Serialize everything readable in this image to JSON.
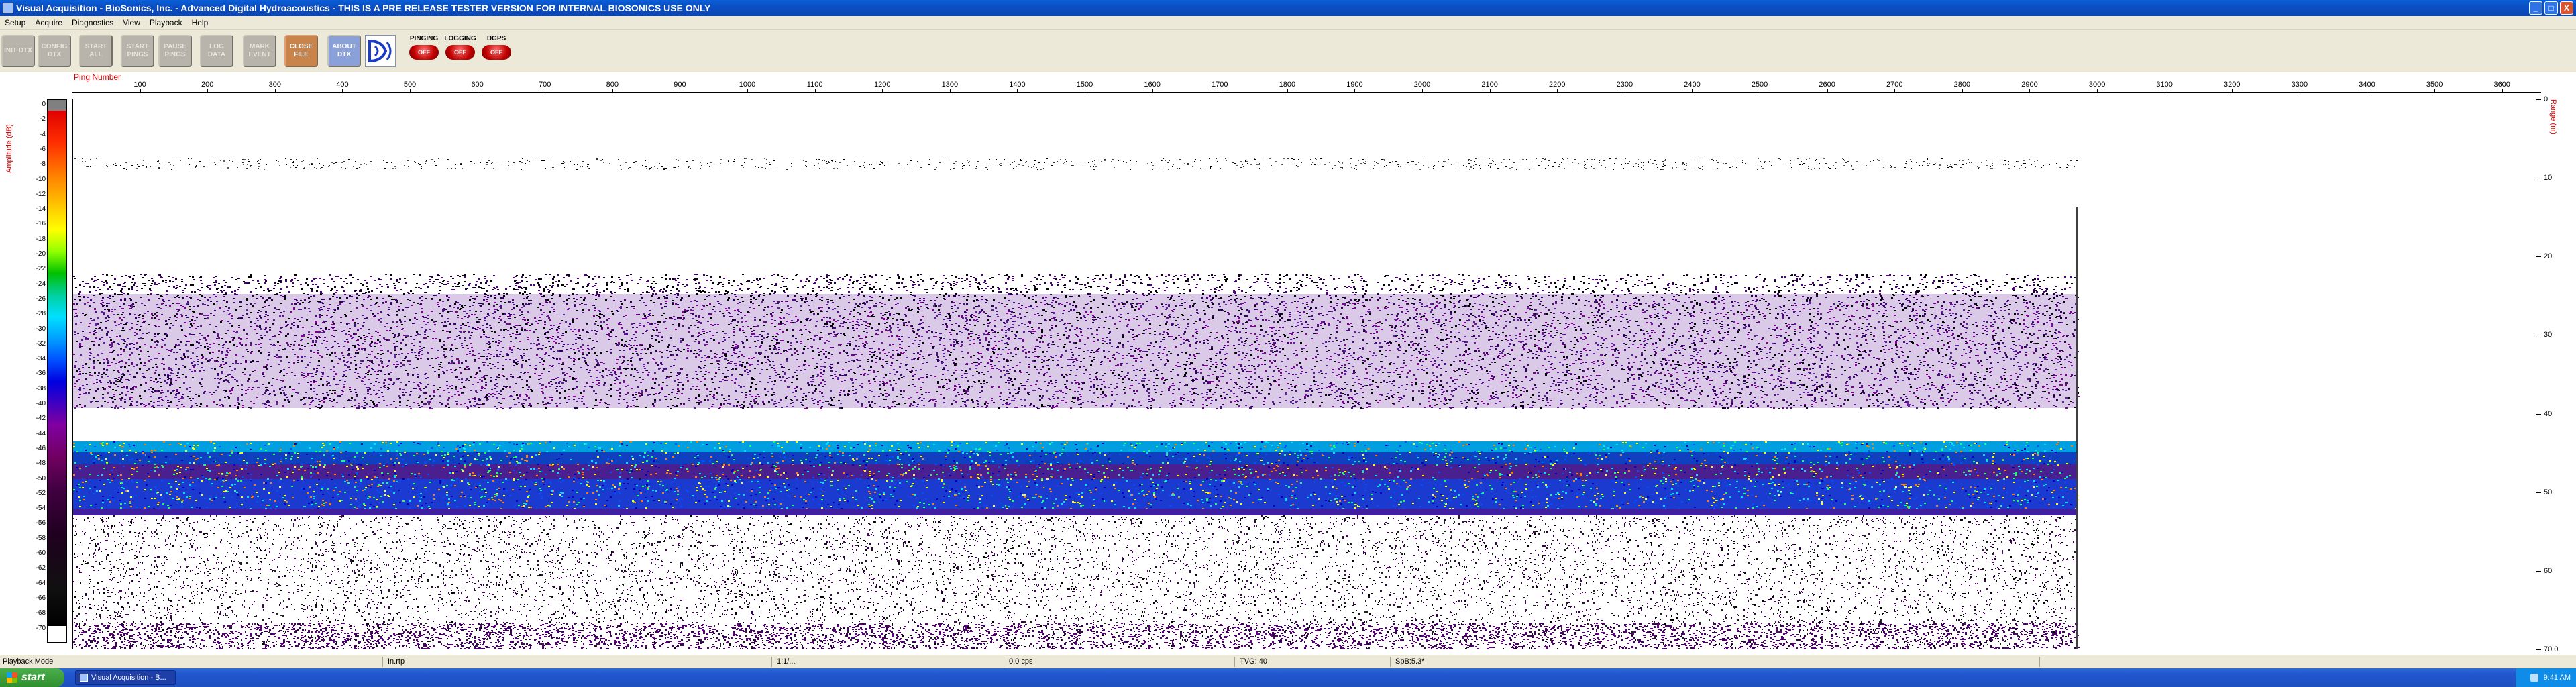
{
  "window": {
    "title": "Visual Acquisition  -  BioSonics, Inc.  -  Advanced Digital Hydroacoustics  -  THIS IS A PRE RELEASE TESTER VERSION FOR INTERNAL BIOSONICS USE ONLY",
    "min_label": "_",
    "max_label": "□",
    "close_label": "X"
  },
  "menu": [
    "Setup",
    "Acquire",
    "Diagnostics",
    "View",
    "Playback",
    "Help"
  ],
  "toolbar": {
    "buttons": [
      {
        "label": "INIT DTX"
      },
      {
        "label": "CONFIG DTX"
      },
      {
        "label": "START ALL"
      },
      {
        "label": "START PINGS"
      },
      {
        "label": "PAUSE PINGS"
      },
      {
        "label": "LOG DATA"
      },
      {
        "label": "MARK EVENT"
      },
      {
        "label": "CLOSE FILE"
      },
      {
        "label": "ABOUT DTX"
      }
    ],
    "status": [
      {
        "title": "PINGING",
        "state": "OFF"
      },
      {
        "title": "LOGGING",
        "state": "OFF"
      },
      {
        "title": "DGPS",
        "state": "OFF"
      }
    ]
  },
  "echogram": {
    "ping_label": "Ping Number",
    "amplitude_label": "Amplitude (dB)",
    "range_label": "Range (m)",
    "x_ticks": [
      "100",
      "200",
      "300",
      "400",
      "500",
      "600",
      "700",
      "800",
      "900",
      "1000",
      "1100",
      "1200",
      "1300",
      "1400",
      "1500",
      "1600",
      "1700",
      "1800",
      "1900",
      "2000",
      "2100",
      "2200",
      "2300",
      "2400",
      "2500",
      "2600",
      "2700",
      "2800",
      "2900",
      "3000",
      "3100",
      "3200",
      "3300",
      "3400",
      "3500",
      "3600"
    ],
    "amp_ticks": [
      "0",
      "-2",
      "-4",
      "-6",
      "-8",
      "-10",
      "-12",
      "-14",
      "-16",
      "-18",
      "-20",
      "-22",
      "-24",
      "-26",
      "-28",
      "-30",
      "-32",
      "-34",
      "-36",
      "-38",
      "-40",
      "-42",
      "-44",
      "-46",
      "-48",
      "-50",
      "-52",
      "-54",
      "-56",
      "-58",
      "-60",
      "-62",
      "-64",
      "-66",
      "-68",
      "-70"
    ],
    "range_ticks": [
      "0",
      "10",
      "20",
      "30",
      "40",
      "50",
      "60",
      "70.0"
    ],
    "data_pings": 2970,
    "max_ping": 3650
  },
  "statusbar": {
    "mode": "Playback Mode",
    "file": "In.rtp",
    "time": "1:1/...",
    "gps": "0.0 cps",
    "tvg": "TVG: 40",
    "spb": "SpB:5.3*"
  },
  "taskbar": {
    "start_label": "start",
    "task_label": "Visual Acquisition  -  B...",
    "clock": "9:41 AM"
  }
}
